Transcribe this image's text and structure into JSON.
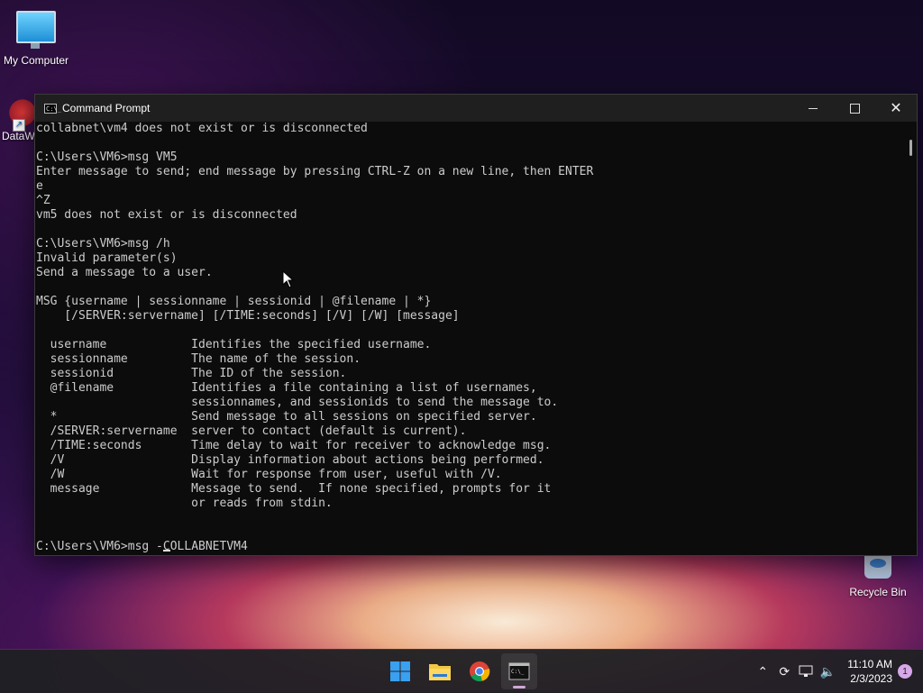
{
  "desktop": {
    "icons": [
      {
        "label": "My Computer"
      },
      {
        "label": "DataW"
      },
      {
        "label": "Recycle Bin"
      }
    ]
  },
  "window": {
    "title": "Command Prompt",
    "icon_text": "C:\\_"
  },
  "console": {
    "lines": [
      "collabnet\\vm4 does not exist or is disconnected",
      "",
      "C:\\Users\\VM6>msg VM5",
      "Enter message to send; end message by pressing CTRL-Z on a new line, then ENTER",
      "e",
      "^Z",
      "vm5 does not exist or is disconnected",
      "",
      "C:\\Users\\VM6>msg /h",
      "Invalid parameter(s)",
      "Send a message to a user.",
      "",
      "MSG {username | sessionname | sessionid | @filename | *}",
      "    [/SERVER:servername] [/TIME:seconds] [/V] [/W] [message]",
      "",
      "  username            Identifies the specified username.",
      "  sessionname         The name of the session.",
      "  sessionid           The ID of the session.",
      "  @filename           Identifies a file containing a list of usernames,",
      "                      sessionnames, and sessionids to send the message to.",
      "  *                   Send message to all sessions on specified server.",
      "  /SERVER:servername  server to contact (default is current).",
      "  /TIME:seconds       Time delay to wait for receiver to acknowledge msg.",
      "  /V                  Display information about actions being performed.",
      "  /W                  Wait for response from user, useful with /V.",
      "  message             Message to send.  If none specified, prompts for it",
      "                      or reads from stdin.",
      "",
      ""
    ],
    "prompt": "C:\\Users\\VM6>msg -",
    "input_after_cursor": "COLLABNETVM4"
  },
  "taskbar": {
    "apps": [
      {
        "name": "start"
      },
      {
        "name": "file-explorer"
      },
      {
        "name": "chrome"
      },
      {
        "name": "command-prompt"
      }
    ],
    "clock_time": "11:10 AM",
    "clock_date": "2/3/2023",
    "notification_count": "1"
  }
}
